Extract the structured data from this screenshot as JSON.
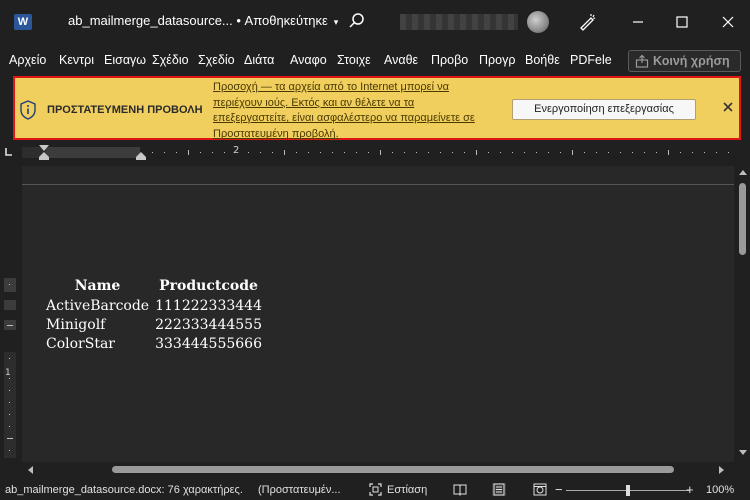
{
  "window": {
    "app_icon_letter": "W",
    "title": "ab_mailmerge_datasource... • Αποθηκεύτηκε",
    "title_caret": "▾",
    "controls": [
      "minimize-icon",
      "maximize-icon",
      "close-icon"
    ]
  },
  "ribbon": {
    "tabs": [
      {
        "label": "Αρχείο"
      },
      {
        "label": "Κεντρι"
      },
      {
        "label": "Εισαγω"
      },
      {
        "label": "Σχέδιο"
      },
      {
        "label": "Σχεδίο"
      },
      {
        "label": "Διάτα"
      },
      {
        "label": "Αναφο"
      },
      {
        "label": "Στοιχε"
      },
      {
        "label": "Αναθε"
      },
      {
        "label": "Προβο"
      },
      {
        "label": "Προγρ"
      },
      {
        "label": "Βοήθε"
      },
      {
        "label": "PDFele"
      }
    ],
    "share_label": "Κοινή χρήση"
  },
  "protected_view": {
    "title": "ΠΡΟΣΤΑΤΕΥΜΕΝΗ ΠΡΟΒΟΛΗ",
    "message": "Προσοχή — τα αρχεία από το Internet μπορεί να περιέχουν ιούς. Εκτός και αν θέλετε να τα επεξεργαστείτε, είναι ασφαλέστερο να παραμείνετε σε Προστατευμένη προβολή.",
    "enable_button": "Ενεργοποίηση επεξεργασίας",
    "border_color": "#e11515",
    "background_color": "#f1cf5f"
  },
  "ruler": {
    "mark": "2",
    "vertical_mark": "1"
  },
  "document": {
    "table": {
      "headers": [
        "Name",
        "Productcode"
      ],
      "rows": [
        [
          "ActiveBarcode",
          "111222333444"
        ],
        [
          "Minigolf",
          "222333444555"
        ],
        [
          "ColorStar",
          "333444555666"
        ]
      ]
    }
  },
  "status_bar": {
    "doc_info": "ab_mailmerge_datasource.docx: 76 χαρακτήρες.",
    "mode": "(Προστατευμέν...",
    "focus_label": "Εστίαση",
    "zoom_minus": "−",
    "zoom_plus": "+",
    "zoom_level": "100%"
  }
}
